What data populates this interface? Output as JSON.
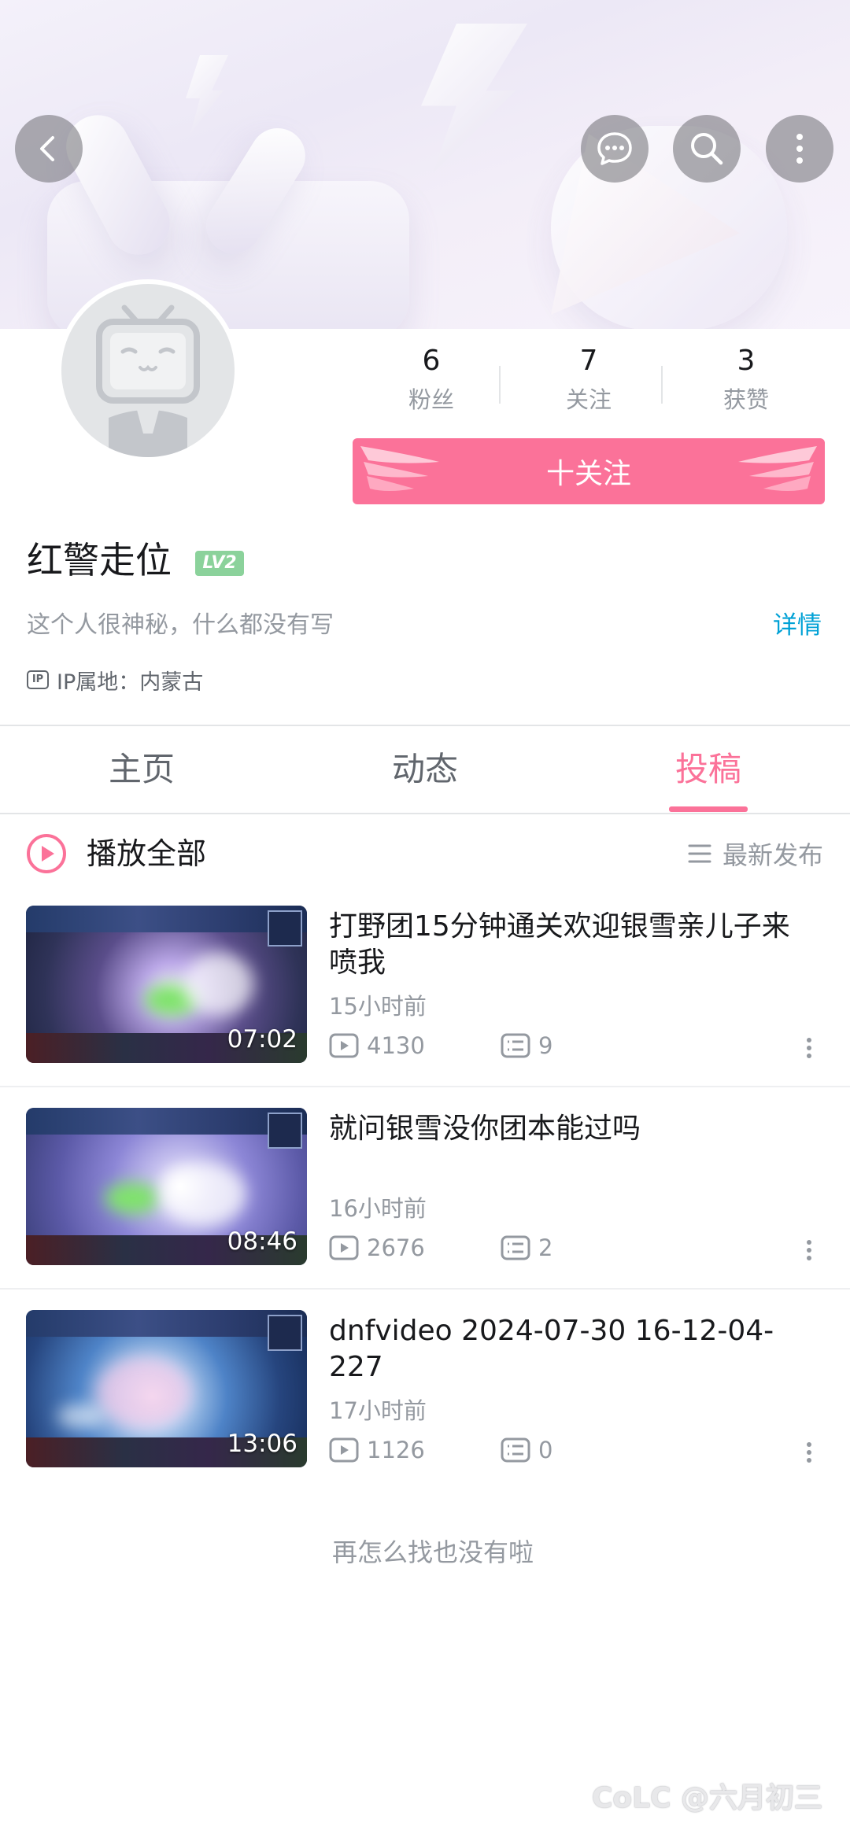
{
  "profile": {
    "username": "红警走位",
    "level": "LV2",
    "bio": "这个人很神秘，什么都没有写",
    "detail_link": "详情",
    "ip_label": "IP属地：内蒙古"
  },
  "stats": [
    {
      "value": "6",
      "label": "粉丝"
    },
    {
      "value": "7",
      "label": "关注"
    },
    {
      "value": "3",
      "label": "获赞"
    }
  ],
  "follow_button": "十关注",
  "tabs": [
    {
      "label": "主页",
      "active": false
    },
    {
      "label": "动态",
      "active": false
    },
    {
      "label": "投稿",
      "active": true
    }
  ],
  "playall": {
    "label": "播放全部",
    "sort_label": "最新发布"
  },
  "videos": [
    {
      "title": "打野团15分钟通关欢迎银雪亲儿子来喷我",
      "time": "15小时前",
      "plays": "4130",
      "comments": "9",
      "duration": "07:02"
    },
    {
      "title": "就问银雪没你团本能过吗",
      "time": "16小时前",
      "plays": "2676",
      "comments": "2",
      "duration": "08:46"
    },
    {
      "title": "dnfvideo 2024-07-30 16-12-04-227",
      "time": "17小时前",
      "plays": "1126",
      "comments": "0",
      "duration": "13:06"
    }
  ],
  "end_text": "再怎么找也没有啦",
  "watermark": "CoLC @六月初三",
  "colors": {
    "accent": "#fb7299",
    "link": "#00a1d6",
    "level": "#8bd29b",
    "muted": "#9499a0"
  },
  "icons": [
    "back-icon",
    "message-icon",
    "search-icon",
    "more-icon",
    "play-all-icon",
    "sort-icon",
    "play-count-icon",
    "comment-count-icon",
    "more-dots-icon"
  ]
}
